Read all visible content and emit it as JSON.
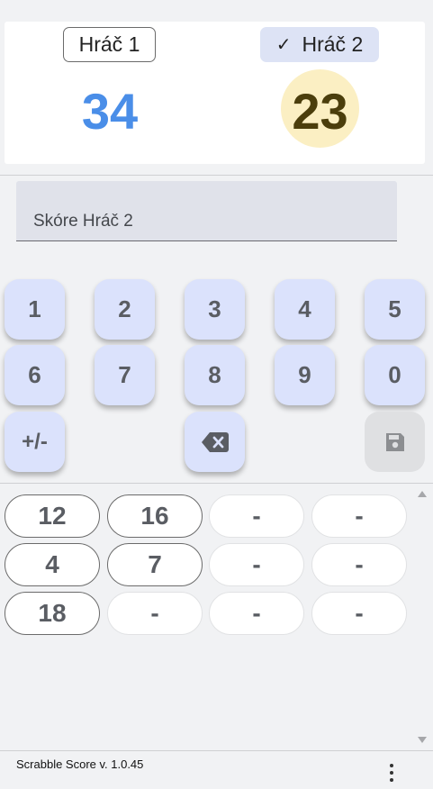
{
  "players": [
    {
      "name": "Hráč 1",
      "score": "34",
      "active": false
    },
    {
      "name": "Hráč 2",
      "score": "23",
      "active": true
    }
  ],
  "active_check": "✓",
  "input": {
    "placeholder": "Skóre Hráč 2",
    "value": ""
  },
  "keypad": {
    "keys": [
      "1",
      "2",
      "3",
      "4",
      "5",
      "6",
      "7",
      "8",
      "9",
      "0"
    ],
    "sign": "+/-",
    "backspace_icon": "backspace-icon",
    "save_icon": "save-icon",
    "save_enabled": false
  },
  "history": {
    "rows": [
      [
        "12",
        "16",
        "-",
        "-"
      ],
      [
        "4",
        "7",
        "-",
        "-"
      ],
      [
        "18",
        "-",
        "-",
        "-"
      ]
    ]
  },
  "footer": {
    "version": "Scrabble Score v. 1.0.45",
    "menu_icon": "more-vert-icon"
  },
  "colors": {
    "player1_score": "#4a8ee8",
    "player2_score": "#4b3e0c",
    "player2_highlight": "#fbefc3",
    "key_bg": "#dbe2fc"
  }
}
